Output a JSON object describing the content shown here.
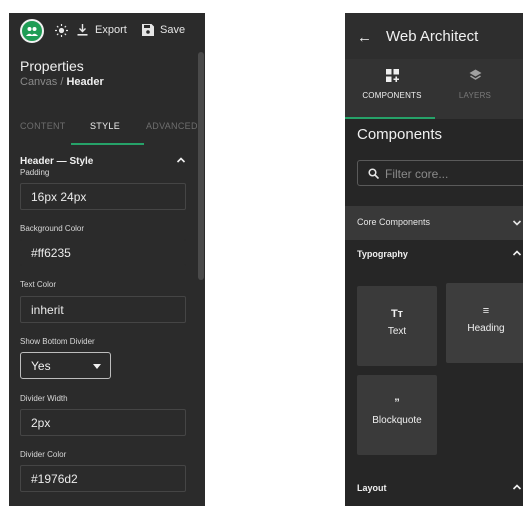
{
  "toolbar": {
    "export_label": "Export",
    "save_label": "Save"
  },
  "properties": {
    "title": "Properties",
    "breadcrumb_parent": "Canvas",
    "breadcrumb_separator": " / ",
    "breadcrumb_current": "Header"
  },
  "tabs": [
    {
      "label": "CONTENT",
      "active": false
    },
    {
      "label": "STYLE",
      "active": true
    },
    {
      "label": "ADVANCED",
      "active": false
    }
  ],
  "section": {
    "title": "Header — Style"
  },
  "fields": {
    "padding": {
      "label": "Padding",
      "value": "16px 24px"
    },
    "background_color": {
      "label": "Background Color",
      "value": "#ff6235"
    },
    "text_color": {
      "label": "Text Color",
      "value": "inherit"
    },
    "show_bottom_divider": {
      "label": "Show Bottom Divider",
      "value": "Yes"
    },
    "divider_width": {
      "label": "Divider Width",
      "value": "2px"
    },
    "divider_color": {
      "label": "Divider Color",
      "value": "#1976d2"
    }
  },
  "builder": {
    "title": "Web Architect",
    "tabs": [
      {
        "label": "COMPONENTS",
        "active": true,
        "icon": "grid-plus-icon"
      },
      {
        "label": "LAYERS",
        "active": false,
        "icon": "layers-icon"
      }
    ],
    "components_title": "Components",
    "filter_placeholder": "Filter core...",
    "accordion_title": "Core Components",
    "typography_title": "Typography",
    "layout_title": "Layout",
    "cards": [
      {
        "glyph": "Tт",
        "label": "Text",
        "icon": "text-icon"
      },
      {
        "glyph": "≡",
        "label": "Heading",
        "icon": "heading-icon"
      },
      {
        "glyph": "”",
        "label": "Blockquote",
        "icon": "quote-icon"
      }
    ]
  },
  "colors": {
    "accent": "#26a269",
    "panel_bg": "#2b2b2b",
    "card_bg": "#3a3a3a"
  }
}
